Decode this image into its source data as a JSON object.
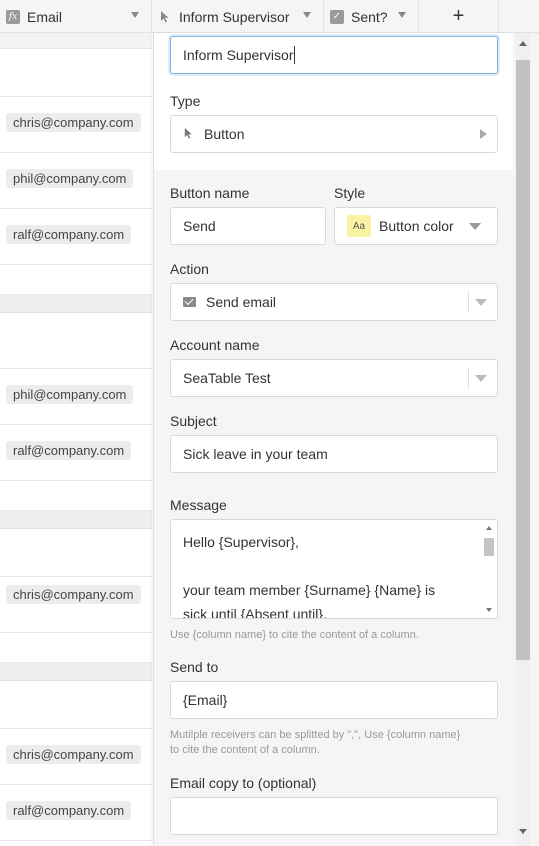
{
  "header": {
    "columns": [
      {
        "label": "Email",
        "icon": "formula-icon"
      },
      {
        "label": "Inform Supervisor",
        "icon": "cursor-icon"
      },
      {
        "label": "Sent?",
        "icon": "checkbox-icon"
      }
    ],
    "add_label": "+"
  },
  "rows": [
    {
      "email": ""
    },
    {
      "email": "chris@company.com"
    },
    {
      "email": "phil@company.com"
    },
    {
      "email": "ralf@company.com"
    },
    {
      "email": ""
    },
    {
      "email": ""
    },
    {
      "email": "phil@company.com"
    },
    {
      "email": "ralf@company.com"
    },
    {
      "email": ""
    },
    {
      "email": ""
    },
    {
      "email": "chris@company.com"
    },
    {
      "email": ""
    },
    {
      "email": ""
    },
    {
      "email": "chris@company.com"
    },
    {
      "email": "ralf@company.com"
    }
  ],
  "panel": {
    "column_name_value": "Inform Supervisor",
    "type_label": "Type",
    "type_value": "Button",
    "button_name_label": "Button name",
    "button_name_value": "Send",
    "style_label": "Style",
    "style_badge": "Aa",
    "style_value": "Button color",
    "action_label": "Action",
    "action_value": "Send email",
    "account_label": "Account name",
    "account_value": "SeaTable Test",
    "subject_label": "Subject",
    "subject_value": "Sick leave in your team",
    "message_label": "Message",
    "message_lines": [
      "Hello {Supervisor},",
      "",
      "your team member {Surname} {Name} is",
      "sick until {Absent until}."
    ],
    "message_hint": "Use {column name} to cite the content of a column.",
    "send_to_label": "Send to",
    "send_to_value": "{Email}",
    "send_to_hint_1": "Mutilple receivers can be splitted by \",\", Use {column name}",
    "send_to_hint_2": "to cite the content of a column.",
    "cc_label": "Email copy to (optional)",
    "cc_value": ""
  },
  "colors": {
    "focus_border": "#7bb3e5",
    "style_badge_bg": "#fbf3a4",
    "panel_bg": "#f5f5f5"
  }
}
